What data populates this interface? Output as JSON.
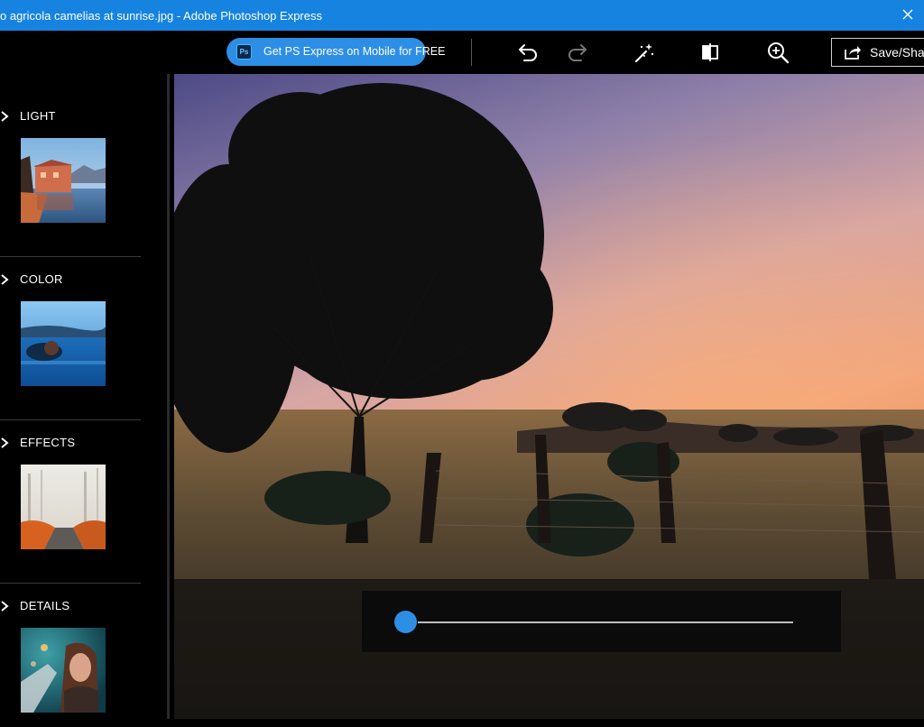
{
  "window": {
    "title": "o agricola camelias at sunrise.jpg - Adobe Photoshop Express"
  },
  "toolbar": {
    "promo_badge": "Ps",
    "promo_label": "Get PS Express on Mobile for FREE",
    "save_label": "Save/Sha",
    "icons": [
      "undo-icon",
      "redo-icon",
      "auto-fix-magic-wand-icon",
      "compare-icon",
      "zoom-in-icon",
      "share-icon"
    ]
  },
  "sidebar": {
    "categories": [
      {
        "label": "LIGHT"
      },
      {
        "label": "COLOR"
      },
      {
        "label": "EFFECTS"
      },
      {
        "label": "DETAILS"
      }
    ]
  },
  "slider": {
    "value": 0
  },
  "colors": {
    "titlebar": "#1683e0",
    "accent": "#2d8ee6",
    "background": "#000000"
  }
}
